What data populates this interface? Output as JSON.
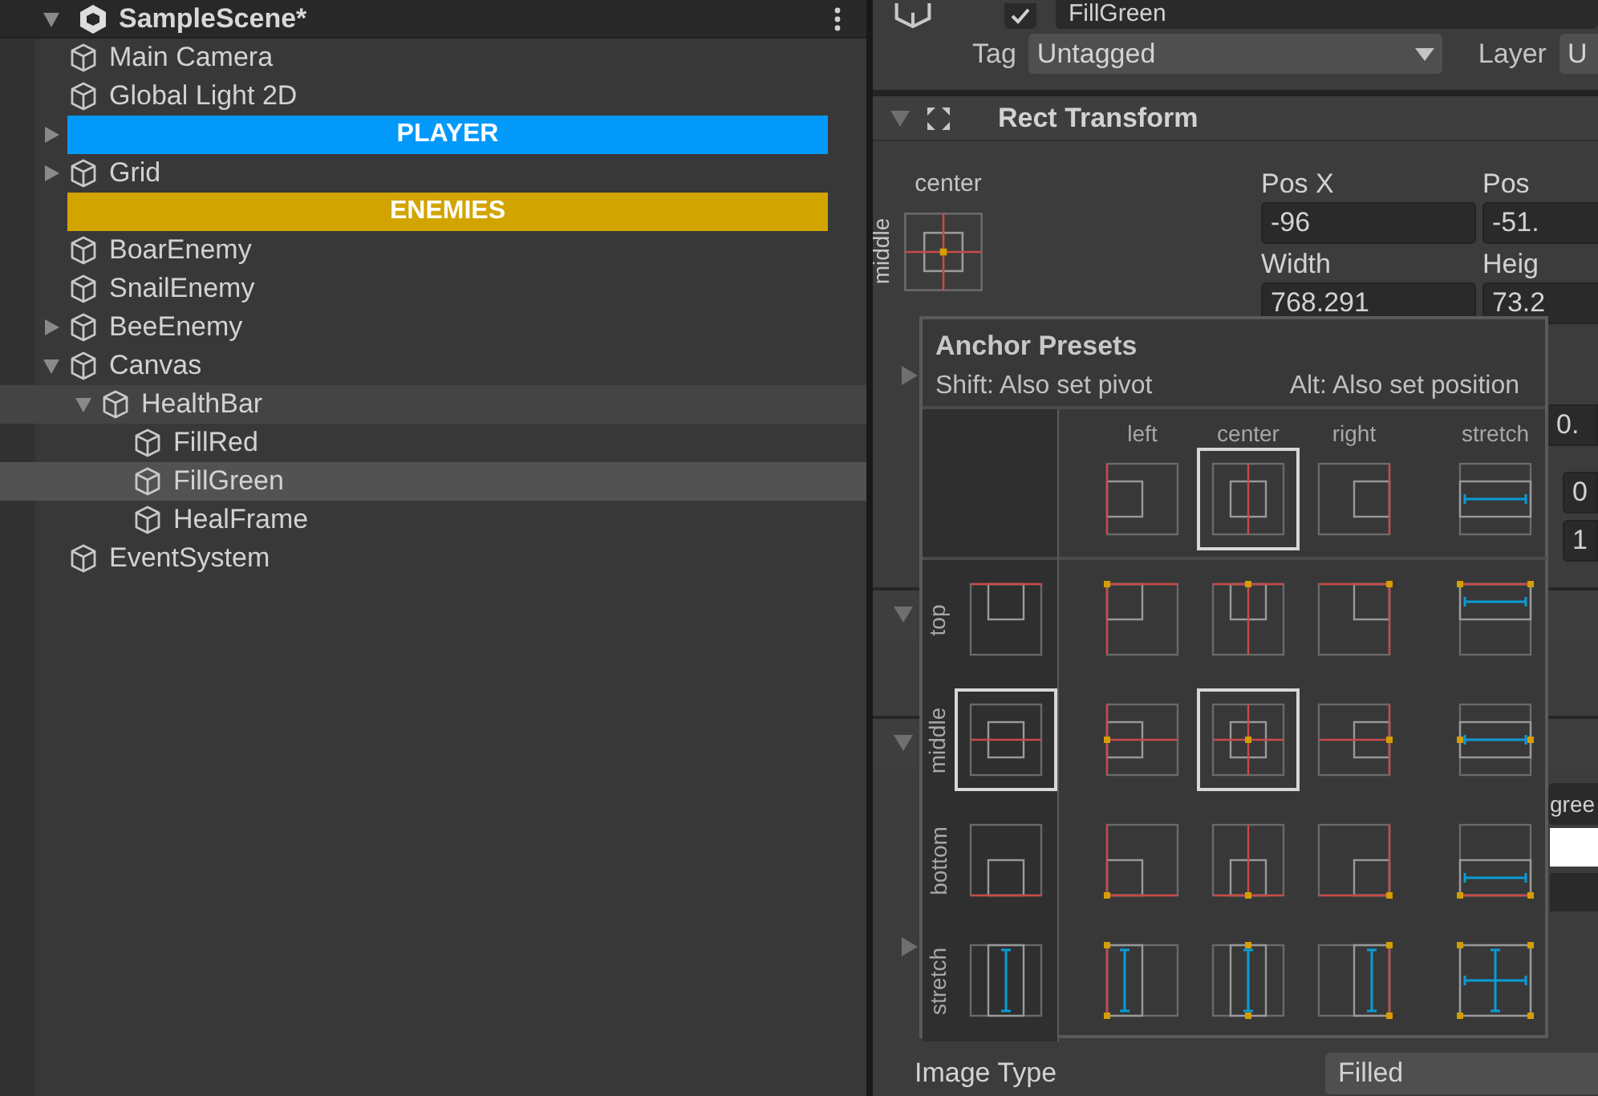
{
  "hierarchy": {
    "scene": {
      "title": "SampleScene*",
      "expanded": true
    },
    "items": [
      {
        "label": "Main Camera",
        "kind": "object",
        "selected": false,
        "hovered": false
      },
      {
        "label": "Global Light 2D",
        "kind": "object",
        "selected": false,
        "hovered": false
      },
      {
        "label": "PLAYER",
        "kind": "header",
        "color": "#0399fa",
        "expanded": false,
        "selected": false,
        "hovered": false
      },
      {
        "label": "Grid",
        "kind": "object",
        "expanded": false,
        "selected": false,
        "hovered": false
      },
      {
        "label": "ENEMIES",
        "kind": "header",
        "color": "#d2a400",
        "selected": false,
        "hovered": false
      },
      {
        "label": "BoarEnemy",
        "kind": "object",
        "selected": false,
        "hovered": false
      },
      {
        "label": "SnailEnemy",
        "kind": "object",
        "selected": false,
        "hovered": false
      },
      {
        "label": "BeeEnemy",
        "kind": "object",
        "expanded": false,
        "selected": false,
        "hovered": false
      },
      {
        "label": "Canvas",
        "kind": "object",
        "expanded": true,
        "selected": false,
        "hovered": false,
        "children": [
          {
            "label": "HealthBar",
            "kind": "object",
            "expanded": true,
            "selected": false,
            "hovered": true,
            "children": [
              {
                "label": "FillRed",
                "kind": "object",
                "selected": false,
                "hovered": false
              },
              {
                "label": "FillGreen",
                "kind": "object",
                "selected": true,
                "hovered": false
              },
              {
                "label": "HealFrame",
                "kind": "object",
                "selected": false,
                "hovered": false
              }
            ]
          }
        ]
      },
      {
        "label": "EventSystem",
        "kind": "object",
        "selected": false,
        "hovered": false
      }
    ]
  },
  "inspector": {
    "active": true,
    "name": "FillGreen",
    "tag_label": "Tag",
    "tag_value": "Untagged",
    "layer_label": "Layer",
    "layer_value": "U",
    "rect_transform": {
      "title": "Rect Transform",
      "expanded": true,
      "anchor_h": "center",
      "anchor_v": "middle",
      "fields": [
        {
          "label": "Pos X",
          "value": "-96"
        },
        {
          "label": "Pos",
          "value": "-51."
        },
        {
          "label": "Width",
          "value": "768.291"
        },
        {
          "label": "Heig",
          "value": "73.2"
        }
      ],
      "extra_rows": [
        {
          "value": "0."
        },
        {
          "value": "0"
        },
        {
          "value": "1"
        }
      ]
    },
    "color_field": "gree",
    "image_type": {
      "label": "Image Type",
      "value": "Filled"
    }
  },
  "anchor_presets": {
    "title": "Anchor Presets",
    "hint_shift": "Shift: Also set pivot",
    "hint_alt": "Alt: Also set position",
    "columns": [
      {
        "label": "left",
        "kind": "left",
        "selected": false
      },
      {
        "label": "center",
        "kind": "center",
        "selected": true
      },
      {
        "label": "right",
        "kind": "right",
        "selected": false
      },
      {
        "label": "stretch",
        "kind": "stretch",
        "selected": false
      }
    ],
    "rows": [
      {
        "label": "top",
        "kind": "top",
        "selected": false,
        "cells": [
          {
            "selected": false
          },
          {
            "selected": false
          },
          {
            "selected": false
          },
          {
            "selected": false
          }
        ]
      },
      {
        "label": "middle",
        "kind": "middle",
        "selected": true,
        "cells": [
          {
            "selected": false
          },
          {
            "selected": true
          },
          {
            "selected": false
          },
          {
            "selected": false
          }
        ]
      },
      {
        "label": "bottom",
        "kind": "bottom",
        "selected": false,
        "cells": [
          {
            "selected": false
          },
          {
            "selected": false
          },
          {
            "selected": false
          },
          {
            "selected": false
          }
        ]
      },
      {
        "label": "stretch",
        "kind": "stretch",
        "selected": false,
        "cells": [
          {
            "selected": false
          },
          {
            "selected": false
          },
          {
            "selected": false
          },
          {
            "selected": false
          }
        ]
      }
    ]
  }
}
